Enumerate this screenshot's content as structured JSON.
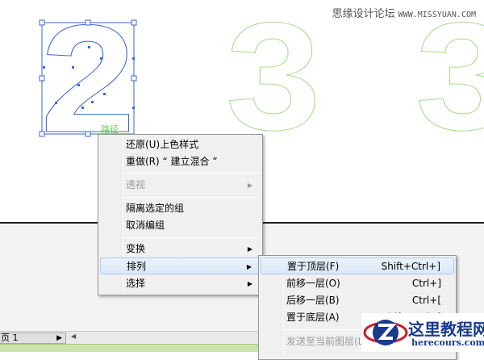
{
  "watermark": {
    "site_cn": "思缘设计论坛",
    "site_url": "WWW.MISSYUAN.COM"
  },
  "canvas": {
    "digits": [
      "2",
      "3",
      "3"
    ],
    "path_label": "路径",
    "colors": {
      "selected": "#3a66d6",
      "outline": "#a6dd86"
    }
  },
  "context_menu": {
    "items": [
      {
        "label": "还原(U)上色样式"
      },
      {
        "label": "重做(R) “ 建立混合 ”"
      },
      {
        "label": "透视",
        "disabled": true,
        "submenu": true
      },
      {
        "label": "隔离选定的组"
      },
      {
        "label": "取消编组"
      },
      {
        "label": "变换",
        "submenu": true
      },
      {
        "label": "排列",
        "submenu": true,
        "highlighted": true
      },
      {
        "label": "选择",
        "submenu": true
      }
    ]
  },
  "arrange_submenu": {
    "items": [
      {
        "label": "置于顶层(F)",
        "shortcut": "Shift+Ctrl+]"
      },
      {
        "label": "前移一层(O)",
        "shortcut": "Ctrl+]"
      },
      {
        "label": "后移一层(B)",
        "shortcut": "Ctrl+["
      },
      {
        "label": "置于底层(A)",
        "shortcut": "Shift+Ctrl+["
      },
      {
        "label": "发送至当前图层(L)",
        "disabled": true
      }
    ]
  },
  "bottom_bar": {
    "page_label": "页 1"
  },
  "logo": {
    "cn": "这里教程网",
    "en": "herecours.com"
  }
}
